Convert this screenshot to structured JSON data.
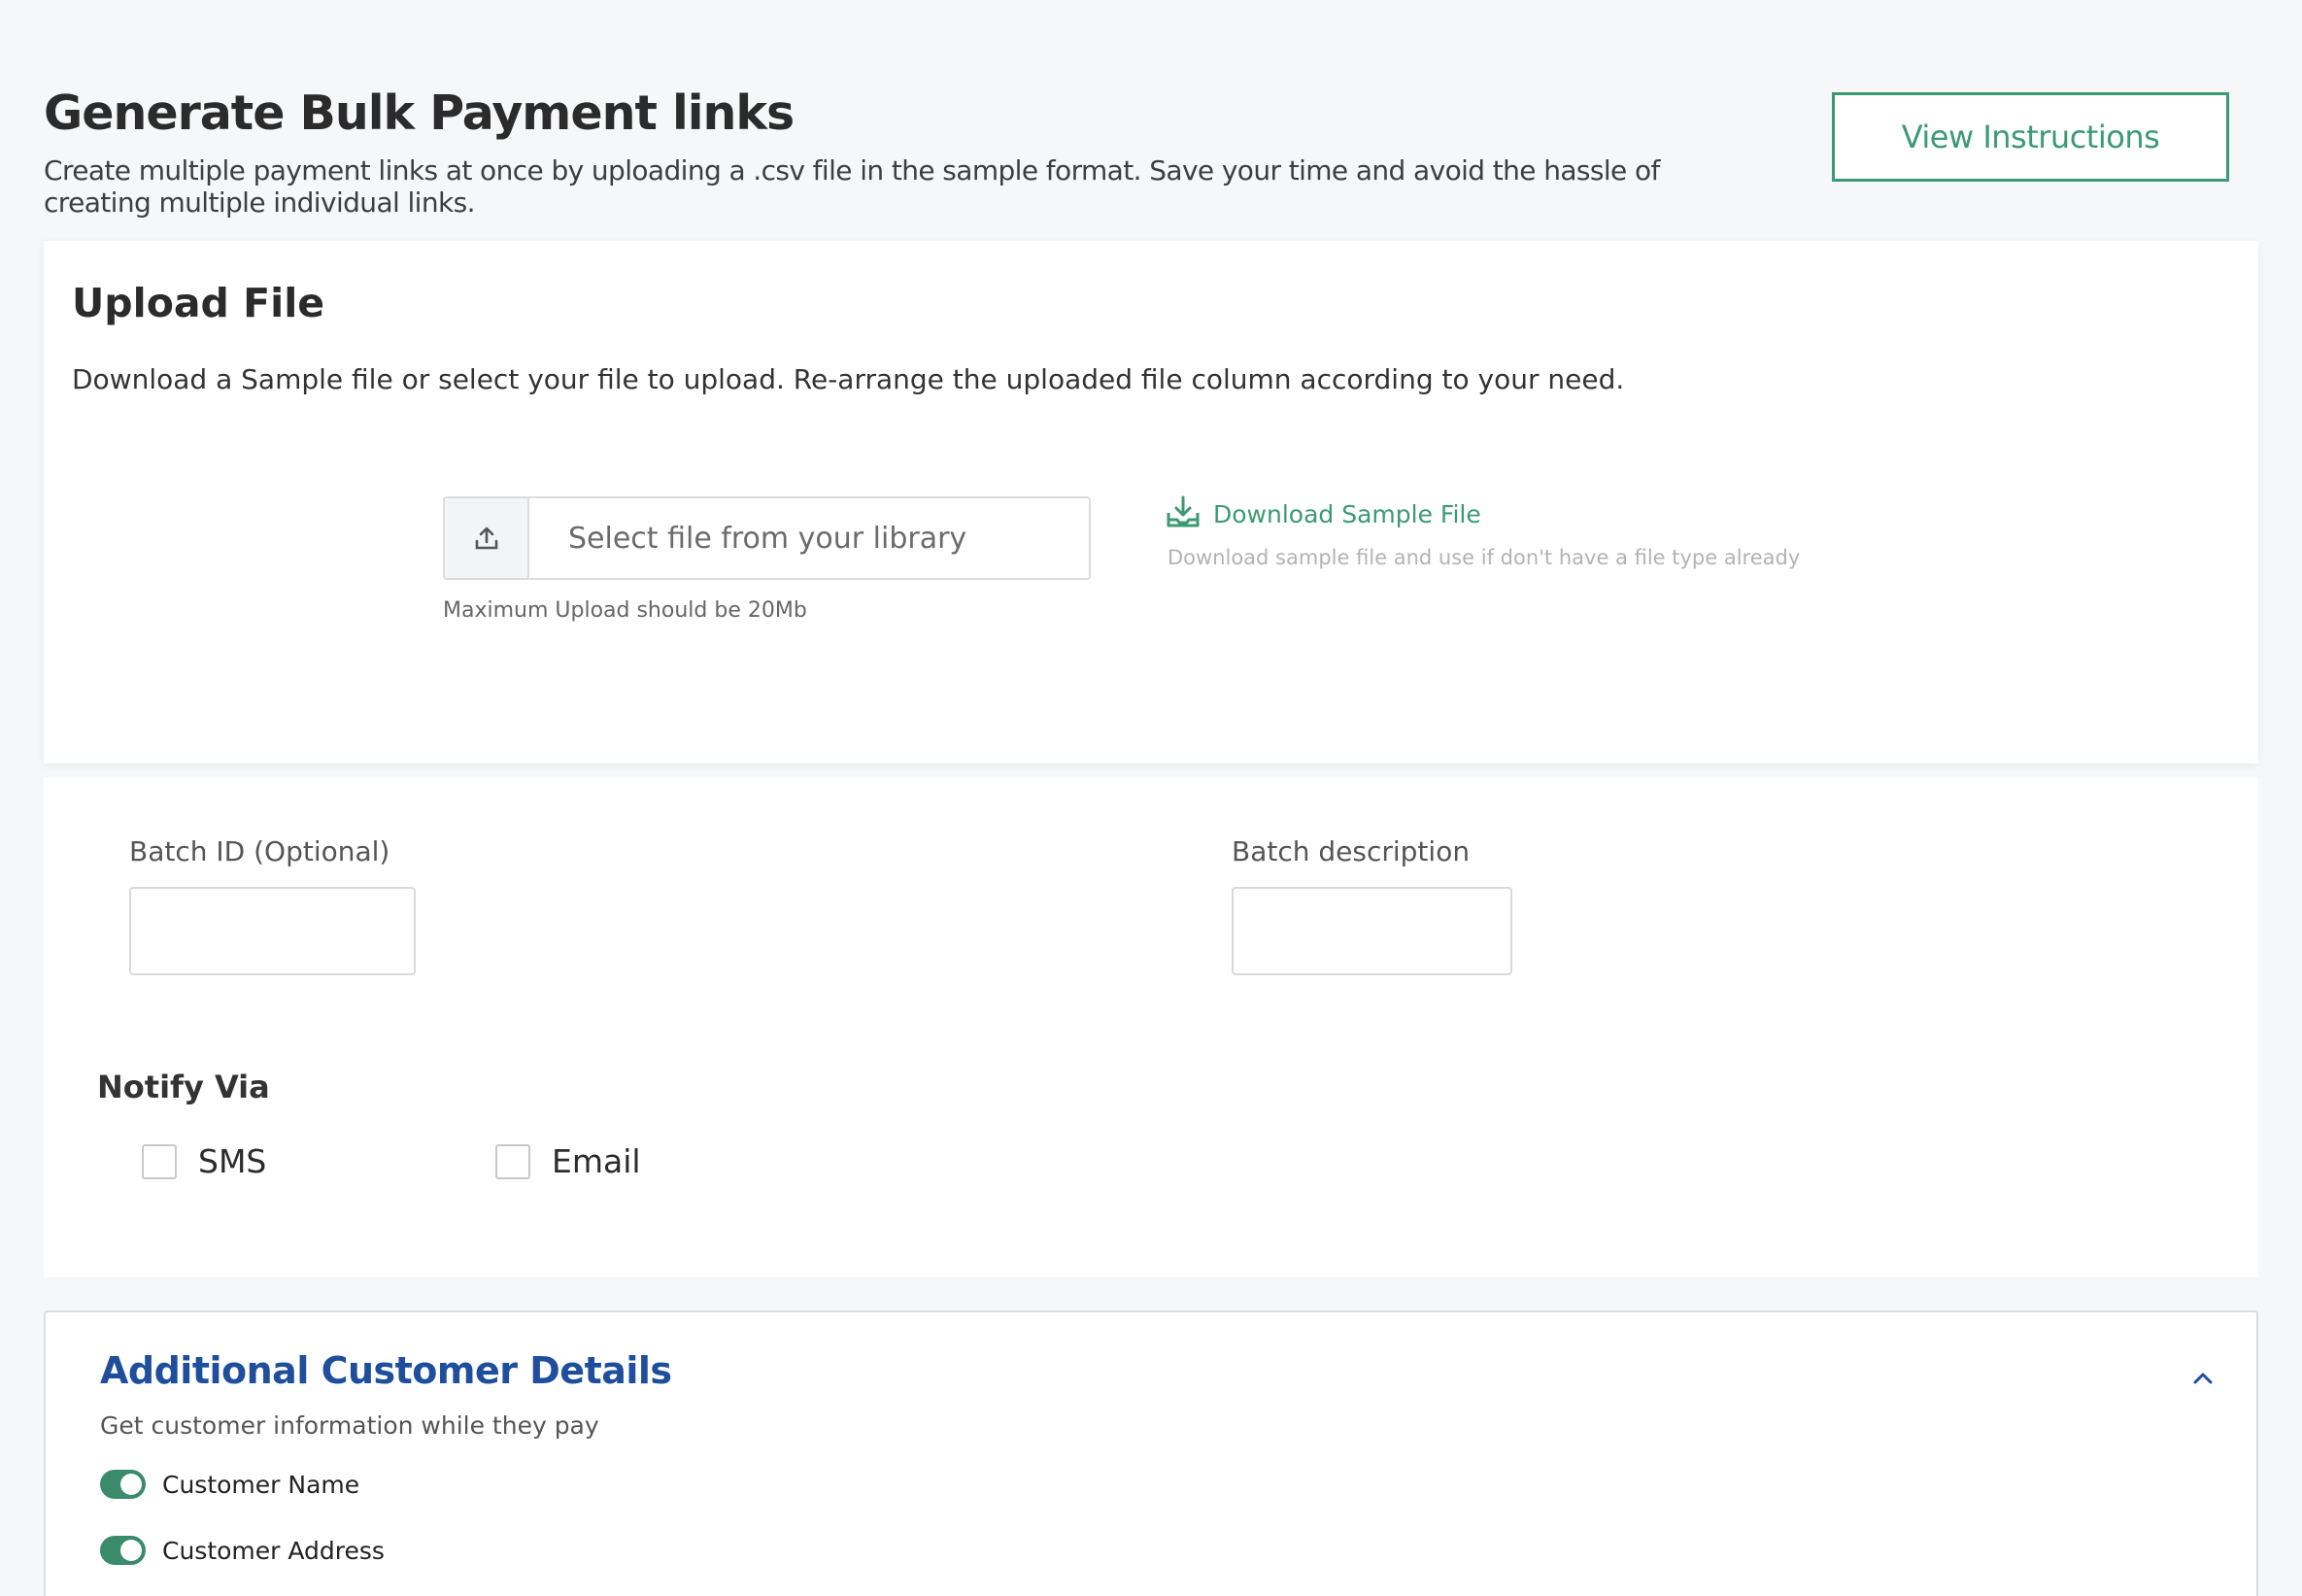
{
  "header": {
    "title": "Generate Bulk Payment links",
    "subtitle": "Create multiple payment links at once by uploading a .csv file in the sample format. Save your time and avoid the hassle of creating multiple individual links.",
    "view_instructions_label": "View Instructions"
  },
  "upload": {
    "title": "Upload File",
    "description": "Download a Sample file or select your file to upload. Re-arrange the uploaded file column according to your need.",
    "file_placeholder": "Select file from your library",
    "max_note": "Maximum Upload should be 20Mb",
    "download_label": "Download Sample File",
    "download_note": "Download sample file and use if don't have a file type already",
    "upload_icon": "upload-icon",
    "download_icon": "download-icon"
  },
  "form": {
    "batch_id_label": "Batch ID (Optional)",
    "batch_id_value": "",
    "batch_desc_label": "Batch description",
    "batch_desc_value": "",
    "notify_title": "Notify Via",
    "notify_options": [
      {
        "label": "SMS",
        "checked": false
      },
      {
        "label": "Email",
        "checked": false
      }
    ]
  },
  "details": {
    "title": "Additional Customer Details",
    "subtitle": "Get customer information while they pay",
    "collapse_icon": "chevron-up-icon",
    "toggles": [
      {
        "label": "Customer Name",
        "on": true
      },
      {
        "label": "Customer Address",
        "on": true
      }
    ]
  },
  "colors": {
    "accent_green": "#3b9a74",
    "toggle_green": "#3b8a6b",
    "title_blue": "#1f4e9c"
  }
}
